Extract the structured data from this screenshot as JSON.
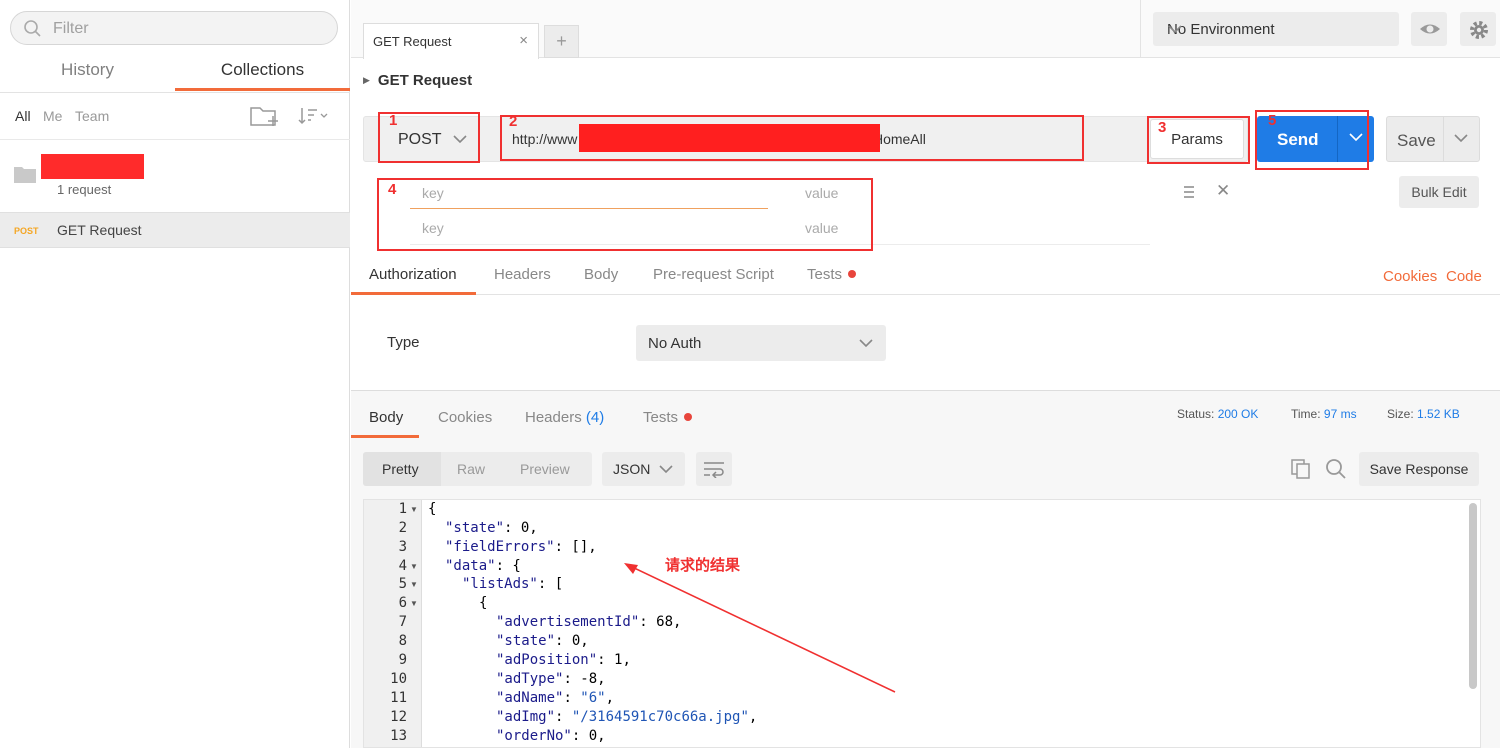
{
  "sidebar": {
    "filter_placeholder": "Filter",
    "tabs": [
      {
        "label": "History"
      },
      {
        "label": "Collections"
      }
    ],
    "owner_filters": [
      {
        "label": "All"
      },
      {
        "label": "Me"
      },
      {
        "label": "Team"
      }
    ],
    "collection": {
      "count": "1 request"
    },
    "request": {
      "method": "POST",
      "name": "GET Request"
    }
  },
  "tabs": {
    "active_tab": "GET Request",
    "close": "×",
    "new_tab": "+"
  },
  "environment": {
    "selected": "No Environment"
  },
  "request": {
    "title": "GET Request",
    "method": "POST",
    "url": "http://www                                                                   sk/listHomeAll",
    "params_label": "Params",
    "send_label": "Send",
    "save_label": "Save",
    "params": [
      {
        "key_placeholder": "key",
        "value_placeholder": "value"
      },
      {
        "key_placeholder": "key",
        "value_placeholder": "value"
      }
    ],
    "bulk_edit": "Bulk Edit",
    "tabs": [
      {
        "label": "Authorization"
      },
      {
        "label": "Headers"
      },
      {
        "label": "Body"
      },
      {
        "label": "Pre-request Script"
      },
      {
        "label": "Tests"
      }
    ],
    "cookies_link": "Cookies",
    "code_link": "Code",
    "auth": {
      "type_label": "Type",
      "selected": "No Auth"
    }
  },
  "response": {
    "tabs": [
      {
        "label": "Body"
      },
      {
        "label": "Cookies"
      },
      {
        "label": "Headers"
      },
      {
        "label": "Tests"
      }
    ],
    "headers_count": "(4)",
    "status_label": "Status:",
    "status_value": "200 OK",
    "time_label": "Time:",
    "time_value": "97 ms",
    "size_label": "Size:",
    "size_value": "1.52 KB",
    "formats": [
      {
        "label": "Pretty"
      },
      {
        "label": "Raw"
      },
      {
        "label": "Preview"
      }
    ],
    "language": "JSON",
    "save_response": "Save Response",
    "line_numbers": [
      "1",
      "2",
      "3",
      "4",
      "5",
      "6",
      "7",
      "8",
      "9",
      "10",
      "11",
      "12",
      "13"
    ]
  },
  "annotations": {
    "numbers": [
      "1",
      "2",
      "3",
      "4",
      "5"
    ],
    "result_text": "请求的结果",
    "color": "#f03030"
  },
  "colors": {
    "accent": "#f26b3a",
    "send": "#1f7ce6",
    "method_badge": "#f5a623"
  }
}
